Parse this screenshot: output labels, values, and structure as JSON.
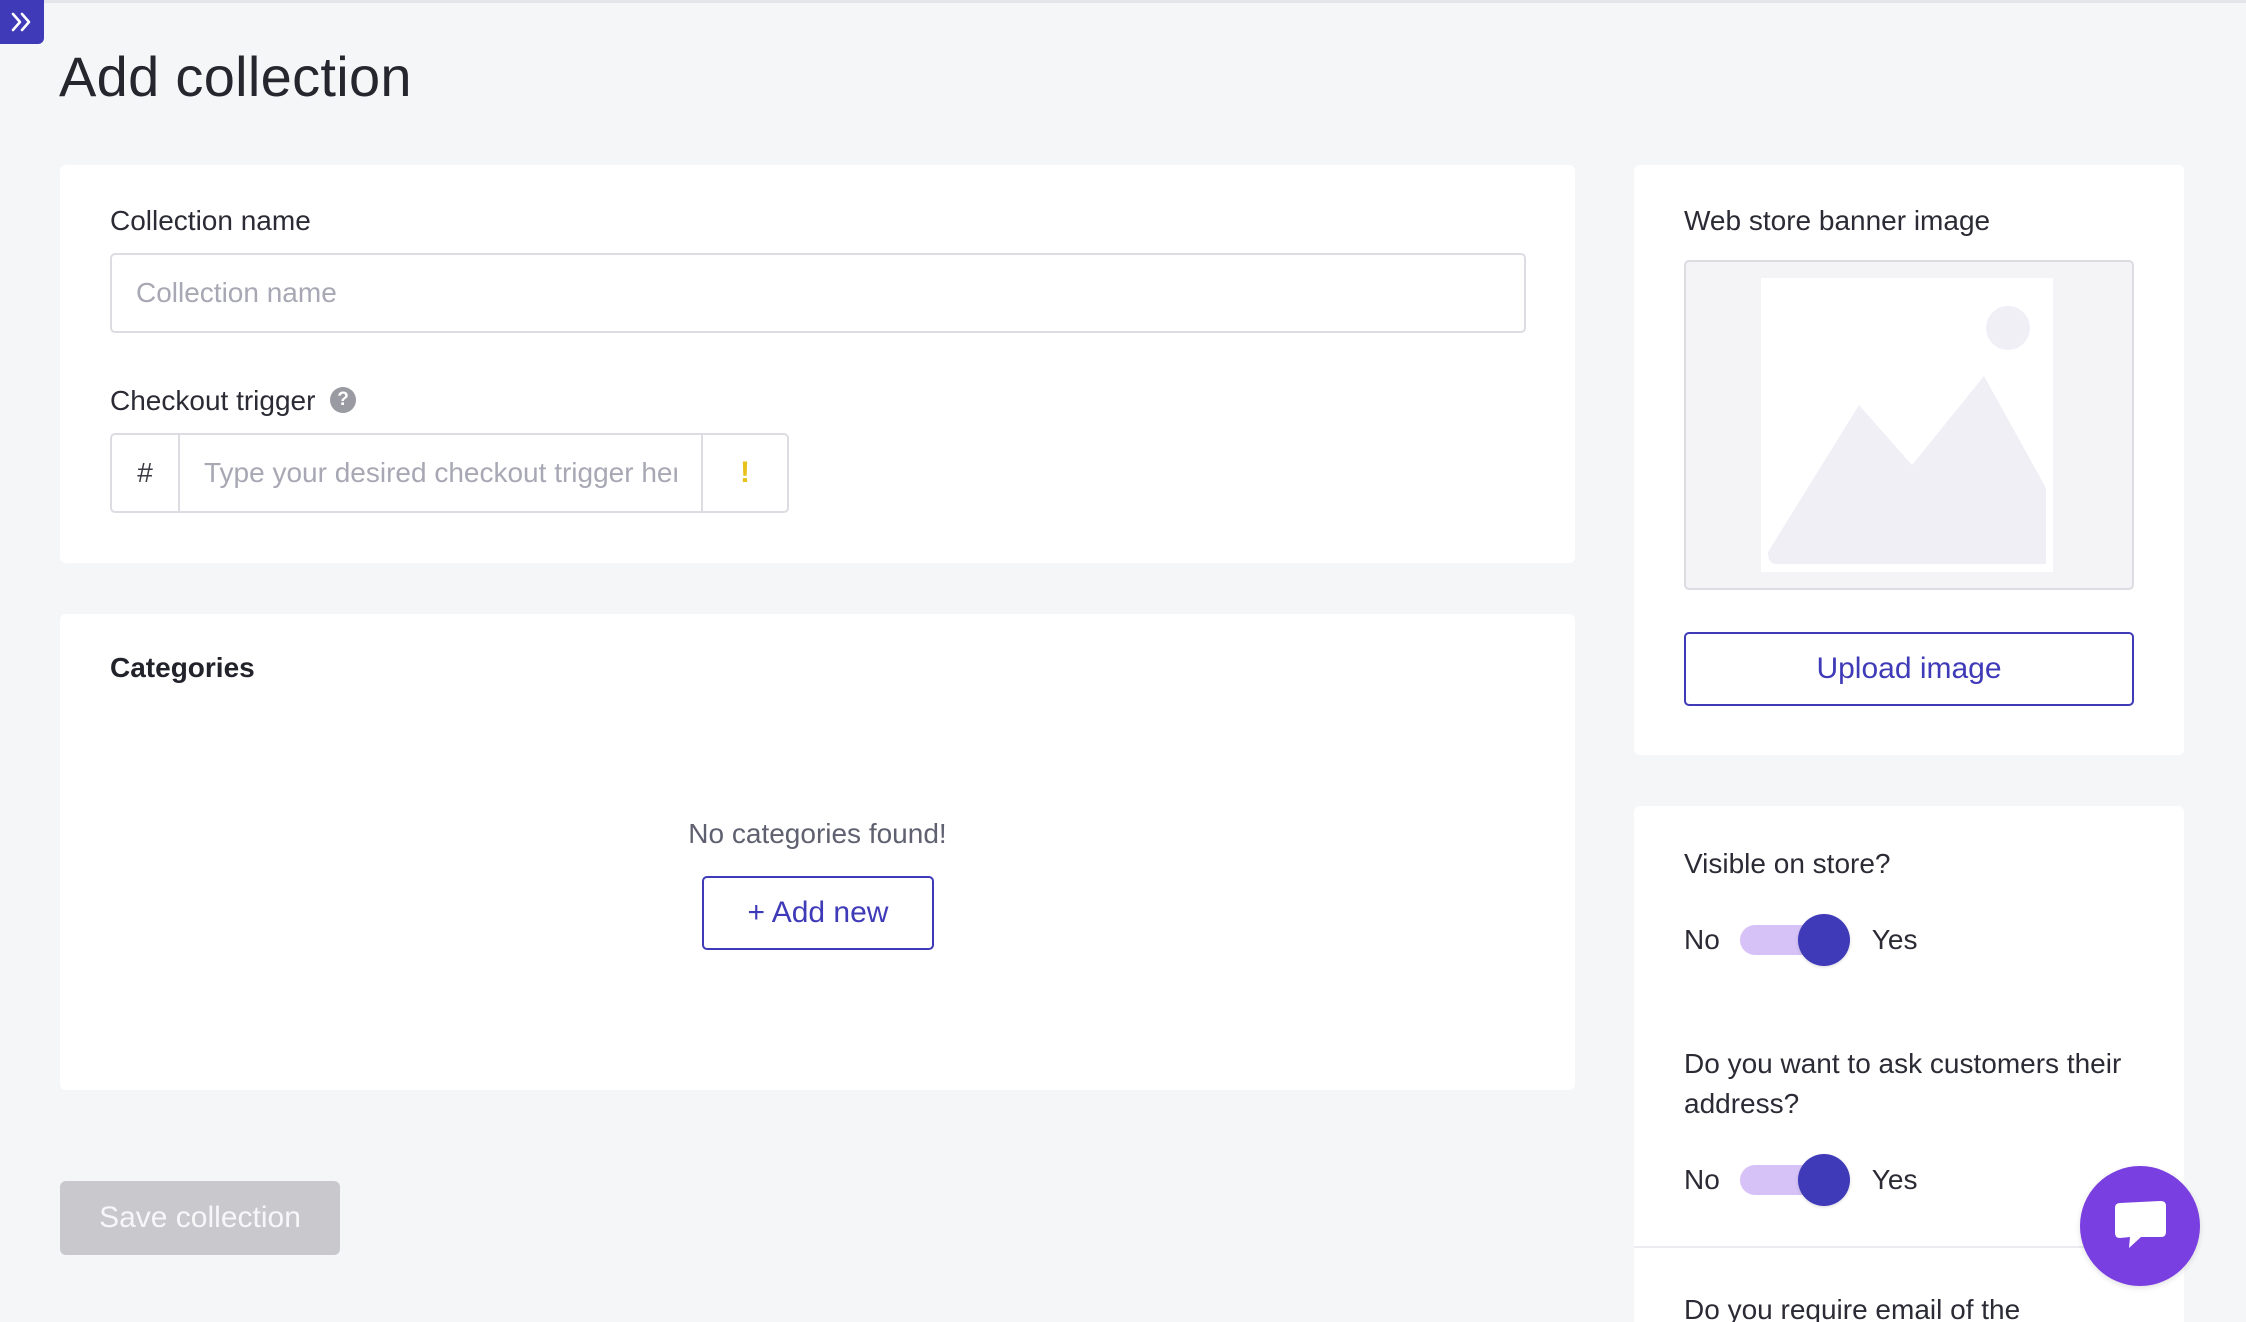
{
  "page": {
    "title": "Add collection"
  },
  "sidebar_toggle": {
    "icon": "double-chevron-right-icon"
  },
  "collection": {
    "name_label": "Collection name",
    "name_placeholder": "Collection name",
    "name_value": "",
    "trigger_label": "Checkout trigger",
    "trigger_prefix": "#",
    "trigger_placeholder": "Type your desired checkout trigger here",
    "trigger_value": "",
    "trigger_warning": "!",
    "help_icon": "question-circle-icon"
  },
  "categories": {
    "title": "Categories",
    "empty_text": "No categories found!",
    "add_new_label": "+ Add new"
  },
  "banner": {
    "label": "Web store banner image",
    "placeholder_icon": "image-placeholder-icon",
    "upload_label": "Upload image"
  },
  "settings": {
    "visible": {
      "question": "Visible on store?",
      "off_label": "No",
      "on_label": "Yes",
      "enabled": true
    },
    "address": {
      "question": "Do you want to ask customers their address?",
      "off_label": "No",
      "on_label": "Yes",
      "enabled": true
    },
    "email": {
      "question": "Do you require email of the"
    }
  },
  "actions": {
    "save_label": "Save collection",
    "save_disabled": true
  },
  "chat": {
    "icon": "chat-bubble-icon"
  },
  "colors": {
    "accent": "#3f3ab8",
    "toggle_track": "#d6c2f7",
    "chat": "#7a3fe0",
    "warning": "#e8c21c",
    "background": "#f5f6f8",
    "disabled_button": "#c9c9cd"
  }
}
